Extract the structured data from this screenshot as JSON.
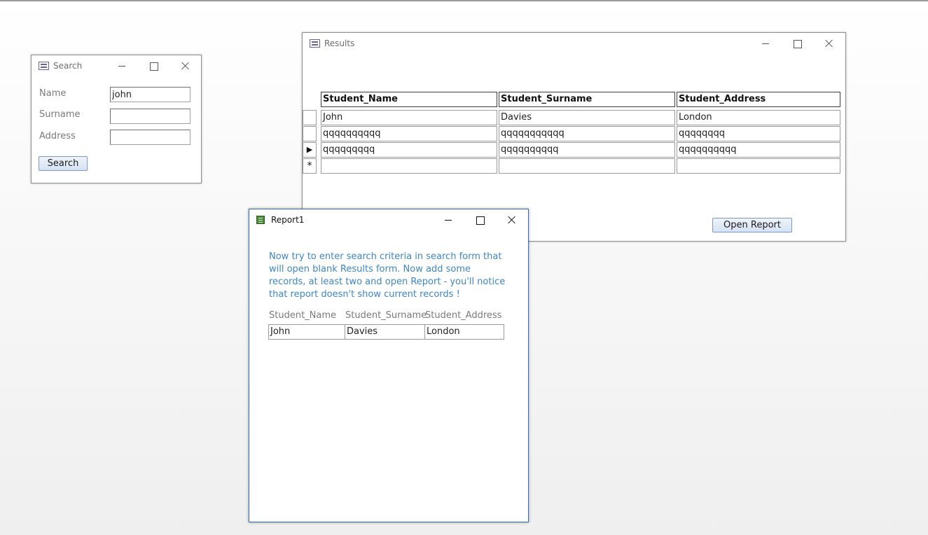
{
  "search_form": {
    "title": "Search",
    "fields": [
      {
        "label": "Name",
        "value": "john"
      },
      {
        "label": "Surname",
        "value": ""
      },
      {
        "label": "Address",
        "value": ""
      }
    ],
    "search_button": "Search",
    "icon": "form-icon"
  },
  "results_form": {
    "title": "Results",
    "icon": "form-icon",
    "columns": [
      "Student_Name",
      "Student_Surname",
      "Student_Address"
    ],
    "rows": [
      [
        "John",
        "Davies",
        "London"
      ],
      [
        "qqqqqqqqqq",
        "qqqqqqqqqqq",
        "qqqqqqqq"
      ],
      [
        "qqqqqqqqq",
        "qqqqqqqqqq",
        "qqqqqqqqqq"
      ]
    ],
    "current_row_marker": "▶",
    "new_row_marker": "*",
    "open_report_button": "Open Report"
  },
  "report": {
    "title": "Report1",
    "icon": "report-icon",
    "message": "Now try to enter search criteria in search form that will open blank Results form. Now add some records, at least two and open Report - you'll notice that report doesn't show current records !",
    "columns": [
      "Student_Name",
      "Student_Surname",
      "Student_Address"
    ],
    "rows": [
      [
        "John",
        "Davies",
        "London"
      ]
    ],
    "message_color": "#3e86c4"
  }
}
